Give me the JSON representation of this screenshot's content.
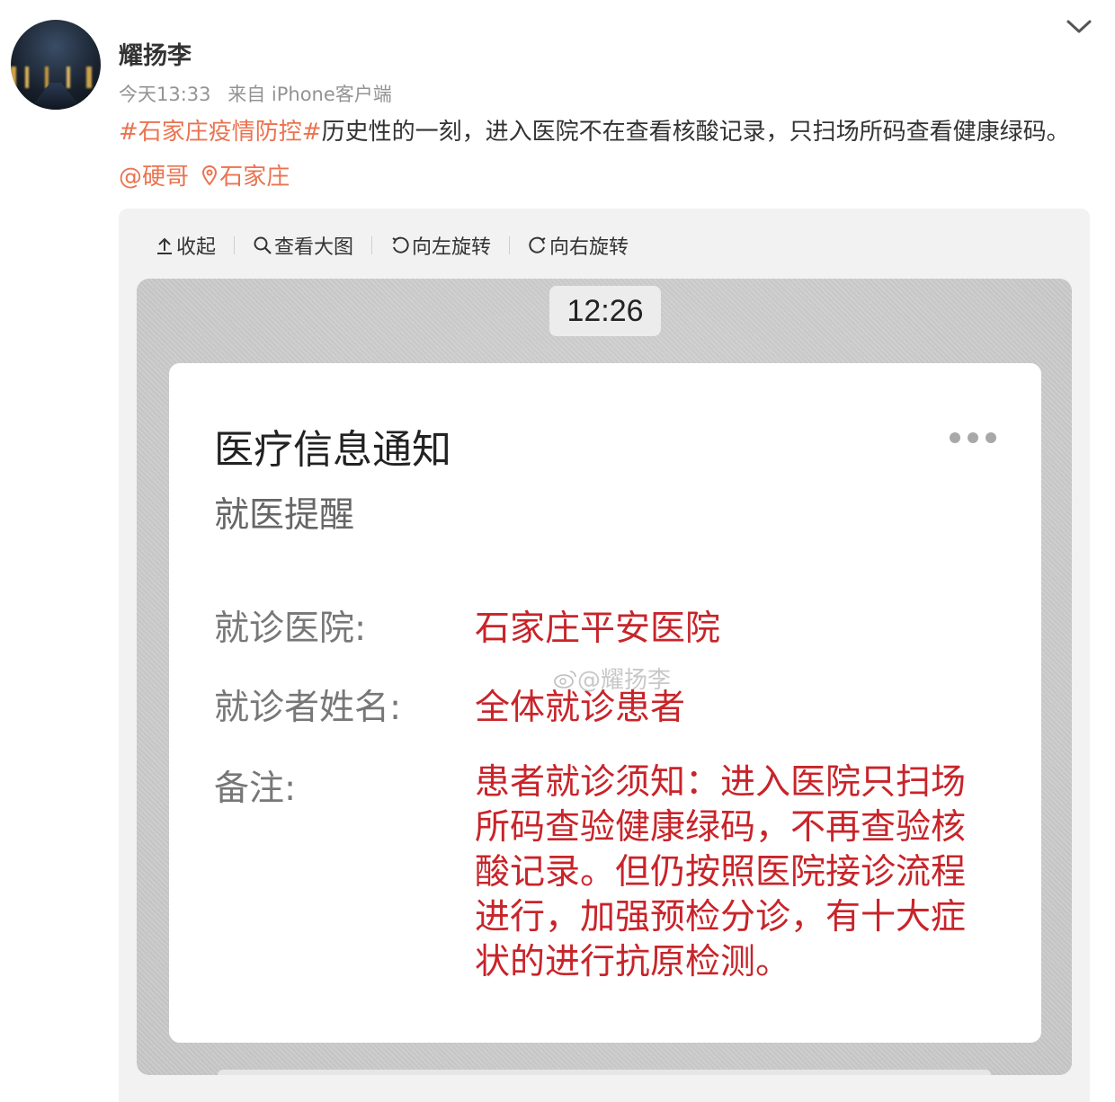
{
  "post": {
    "username": "耀扬李",
    "time": "今天13:33",
    "source": "来自 iPhone客户端",
    "hashtag": "#石家庄疫情防控#",
    "text": "历史性的一刻，进入医院不在查看核酸记录，只扫场所码查看健康绿码。",
    "mention": "@硬哥",
    "location": "石家庄"
  },
  "toolbar": {
    "collapse": "收起",
    "view_large": "查看大图",
    "rotate_left": "向左旋转",
    "rotate_right": "向右旋转"
  },
  "image": {
    "clock": "12:26",
    "notice_title": "医疗信息通知",
    "notice_subtitle": "就医提醒",
    "hospital_label": "就诊医院:",
    "hospital_value": "石家庄平安医院",
    "patient_label": "就诊者姓名:",
    "patient_value": "全体就诊患者",
    "remark_label": "备注:",
    "remark_value": "患者就诊须知：进入医院只扫场所码查验健康绿码，不再查验核酸记录。但仍按照医院接诊流程进行，加强预检分诊，有十大症状的进行抗原检测。",
    "watermark": "@耀扬李"
  },
  "colors": {
    "link": "#eb7350",
    "notice_red": "#c8242a"
  },
  "icons": [
    "chevron-down-icon",
    "collapse-up-icon",
    "search-icon",
    "rotate-left-icon",
    "rotate-right-icon",
    "location-pin-icon",
    "more-dots-icon",
    "weibo-icon"
  ]
}
